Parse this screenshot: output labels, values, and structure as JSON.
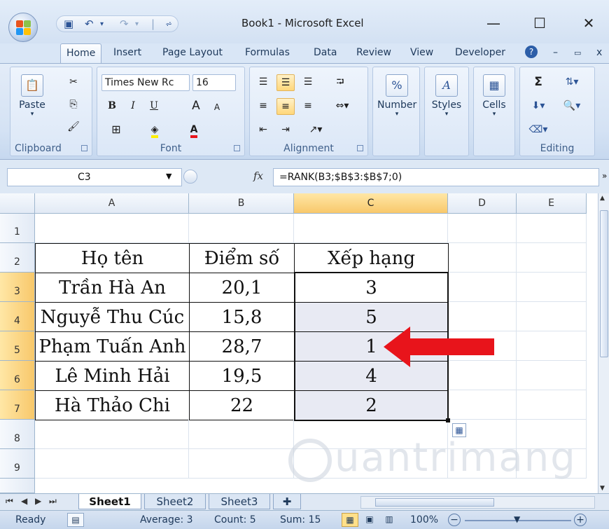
{
  "window": {
    "title": "Book1 - Microsoft Excel",
    "minimize": "—",
    "maximize": "☐",
    "close": "✕"
  },
  "qat": {
    "separator": "|",
    "customize": "⩫"
  },
  "tabs": [
    "Home",
    "Insert",
    "Page Layout",
    "Formulas",
    "Data",
    "Review",
    "View",
    "Developer"
  ],
  "ribbon": {
    "clipboard": {
      "label": "Clipboard",
      "paste": "Paste"
    },
    "font": {
      "label": "Font",
      "family": "Times New Rc",
      "size": "16",
      "bold": "B",
      "italic": "I",
      "underline": "U",
      "grow": "A",
      "shrink": "A",
      "font_color": "A"
    },
    "alignment": {
      "label": "Alignment"
    },
    "number": {
      "label": "Number",
      "icon_text": "%"
    },
    "styles": {
      "label": "Styles"
    },
    "cells": {
      "label": "Cells"
    },
    "editing": {
      "label": "Editing",
      "sum": "Σ"
    }
  },
  "formula_bar": {
    "name_box": "C3",
    "fx": "fx",
    "formula": "=RANK(B3;$B$3:$B$7;0)"
  },
  "columns": [
    "A",
    "B",
    "C",
    "D",
    "E"
  ],
  "rows": [
    "1",
    "2",
    "3",
    "4",
    "5",
    "6",
    "7",
    "8",
    "9"
  ],
  "table": {
    "headers": [
      "Họ tên",
      "Điểm số",
      "Xếp hạng"
    ],
    "rows": [
      [
        "Trần Hà An",
        "20,1",
        "3"
      ],
      [
        "Nguyễ Thu Cúc",
        "15,8",
        "5"
      ],
      [
        "Phạm Tuấn Anh",
        "28,7",
        "1"
      ],
      [
        "Lê Minh Hải",
        "19,5",
        "4"
      ],
      [
        "Hà Thảo Chi",
        "22",
        "2"
      ]
    ]
  },
  "watermark": "uantrimang",
  "sheets": [
    "Sheet1",
    "Sheet2",
    "Sheet3"
  ],
  "status": {
    "ready": "Ready",
    "average": "Average: 3",
    "count": "Count: 5",
    "sum": "Sum: 15",
    "zoom": "100%"
  },
  "colors": {
    "arrow": "#e8141b",
    "selection_fill": "#e8eaf3",
    "header_highlight": "#f8c86b"
  }
}
